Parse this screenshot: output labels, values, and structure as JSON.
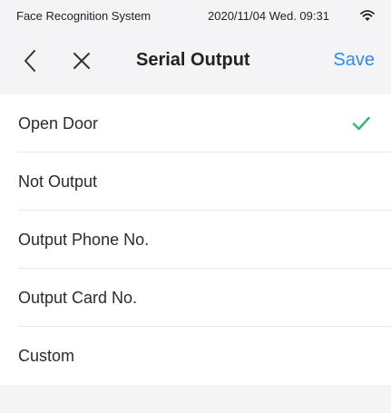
{
  "status_bar": {
    "app_name": "Face Recognition System",
    "datetime": "2020/11/04  Wed.  09:31",
    "wifi_icon": "wifi-icon"
  },
  "nav_bar": {
    "back_icon": "chevron-left-icon",
    "close_icon": "close-icon",
    "title": "Serial Output",
    "save_label": "Save"
  },
  "colors": {
    "accent": "#2d8ce6",
    "check": "#3cb67a",
    "background": "#f4f4f6"
  },
  "options": [
    {
      "label": "Open Door",
      "selected": true
    },
    {
      "label": "Not Output",
      "selected": false
    },
    {
      "label": "Output Phone No.",
      "selected": false
    },
    {
      "label": "Output Card No.",
      "selected": false
    },
    {
      "label": "Custom",
      "selected": false
    }
  ]
}
